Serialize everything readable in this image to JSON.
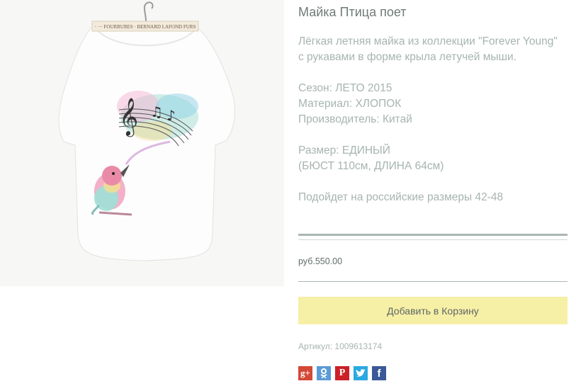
{
  "product": {
    "title": "Майка Птица поет",
    "description": "Лёгкая летняя майка из коллекции \"Forever Young\" с рукавами в форме крыла летучей мыши.",
    "season": "Сезон: ЛЕТО 2015",
    "material": "Материал: ХЛОПОК",
    "manufacturer": "Производитель: Китай",
    "size": "Размер: ЕДИНЫЙ",
    "measurements": "(БЮСТ 110см, ДЛИНА 64см)",
    "fit_note": "Подойдет на российские размеры 42-48",
    "price": "руб.550.00",
    "add_to_cart_label": "Добавить в Корзину",
    "sku": "Артикул: 1009613174",
    "image_label": "· ··· FOURRURES · BERNARD LAFOND FURS"
  },
  "social": [
    {
      "name": "google-plus",
      "glyph": "g+",
      "color": "#d34836"
    },
    {
      "name": "odnoklassniki",
      "glyph": "",
      "color": "#5b9bd5"
    },
    {
      "name": "pinterest",
      "glyph": "P",
      "color": "#cb2027"
    },
    {
      "name": "twitter",
      "glyph": "",
      "color": "#2ba9e1"
    },
    {
      "name": "facebook",
      "glyph": "f",
      "color": "#3b5998"
    }
  ],
  "colors": {
    "accent_button": "#f6efa6",
    "text_muted": "#a6b5ae",
    "title": "#6d7b76"
  }
}
